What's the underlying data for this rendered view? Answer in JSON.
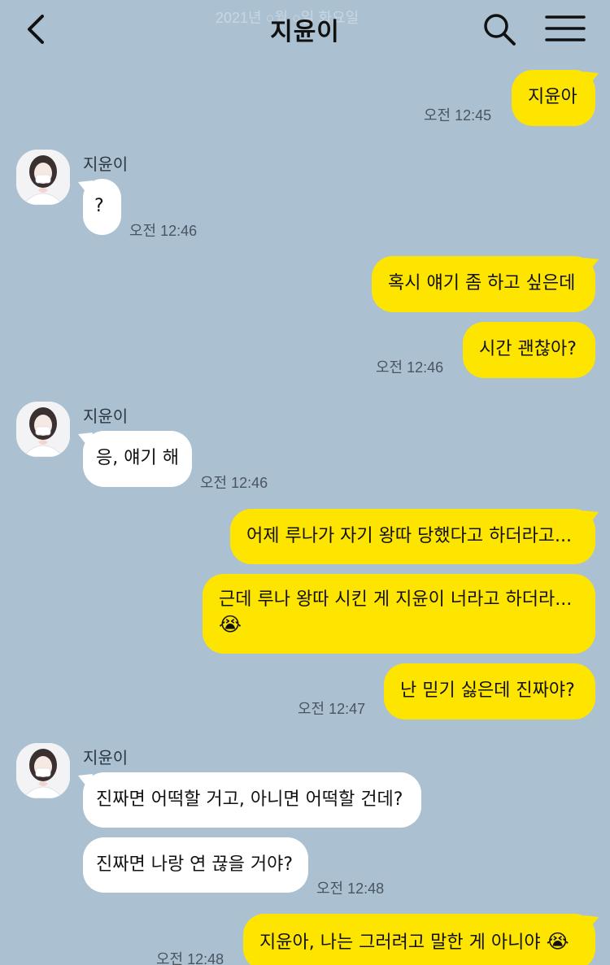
{
  "header": {
    "date_ghost": "2021년 ○월 ○일 화요일",
    "title": "지윤이"
  },
  "colors": {
    "background": "#abc1d1",
    "my_bubble": "#fee500",
    "their_bubble": "#ffffff"
  },
  "messages": [
    {
      "from": "me",
      "text": "지윤아",
      "time": "오전 12:45"
    },
    {
      "from": "them",
      "sender": "지윤이",
      "text": "?",
      "time": "오전 12:46"
    },
    {
      "from": "me",
      "text": "혹시 얘기 좀 하고 싶은데"
    },
    {
      "from": "me",
      "text": "시간 괜찮아?",
      "time": "오전 12:46"
    },
    {
      "from": "them",
      "sender": "지윤이",
      "text": "응, 얘기 해",
      "time": "오전 12:46"
    },
    {
      "from": "me",
      "text": "어제 루나가 자기 왕따 당했다고 하더라고..."
    },
    {
      "from": "me",
      "text": "근데 루나 왕따 시킨 게 지윤이 너라고 하더라...",
      "emoji": "😭"
    },
    {
      "from": "me",
      "text": "난 믿기 싫은데 진짜야?",
      "time": "오전 12:47"
    },
    {
      "from": "them",
      "sender": "지윤이",
      "text": "진짜면 어떡할 거고, 아니면 어떡할 건데?"
    },
    {
      "from": "them",
      "text": "진짜면 나랑 연 끊을 거야?",
      "time": "오전 12:48"
    },
    {
      "from": "me",
      "text": "지윤아, 나는 그러려고 말한 게 아니야",
      "emoji": "😭",
      "time": "오전 12:48"
    }
  ]
}
